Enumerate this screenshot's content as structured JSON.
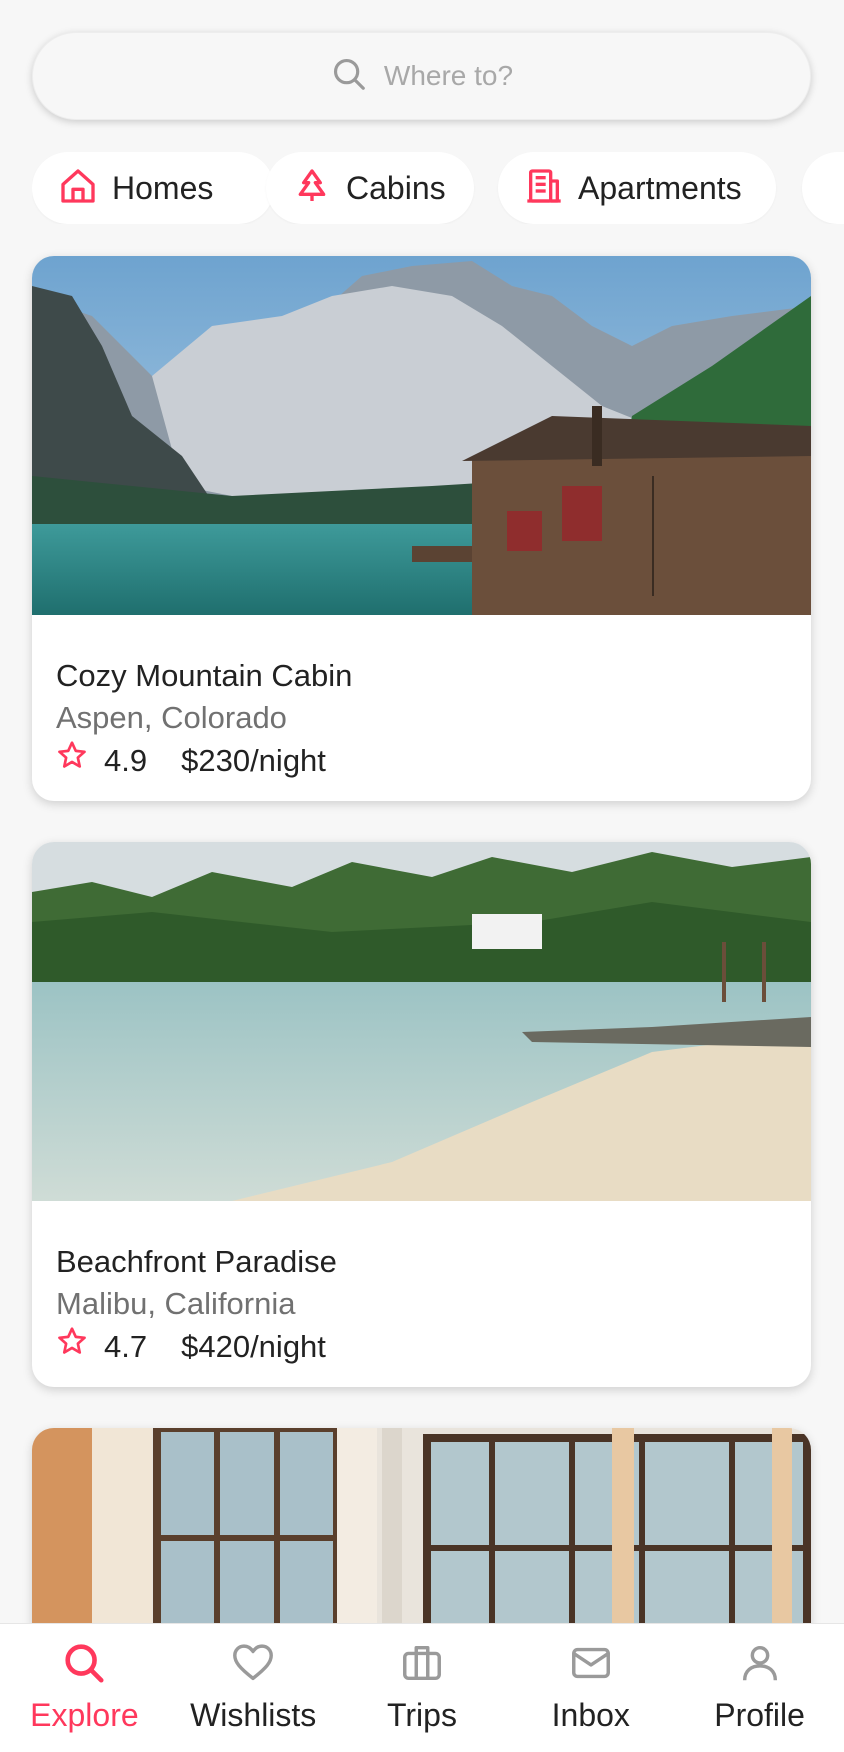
{
  "search": {
    "placeholder": "Where to?"
  },
  "categories": [
    {
      "label": "Homes",
      "icon": "home-icon"
    },
    {
      "label": "Cabins",
      "icon": "tree-icon"
    },
    {
      "label": "Apartments",
      "icon": "building-icon"
    }
  ],
  "listings": [
    {
      "title": "Cozy Mountain Cabin",
      "location": "Aspen, Colorado",
      "rating": "4.9",
      "price": "$230/night"
    },
    {
      "title": "Beachfront Paradise",
      "location": "Malibu, California",
      "rating": "4.7",
      "price": "$420/night"
    }
  ],
  "tabs": [
    {
      "label": "Explore",
      "icon": "search-icon",
      "active": true
    },
    {
      "label": "Wishlists",
      "icon": "heart-icon"
    },
    {
      "label": "Trips",
      "icon": "suitcase-icon"
    },
    {
      "label": "Inbox",
      "icon": "mail-icon"
    },
    {
      "label": "Profile",
      "icon": "person-icon"
    }
  ],
  "colors": {
    "accent": "#ff385c",
    "text": "#222222",
    "muted": "#717171",
    "background": "#f7f7f7"
  }
}
